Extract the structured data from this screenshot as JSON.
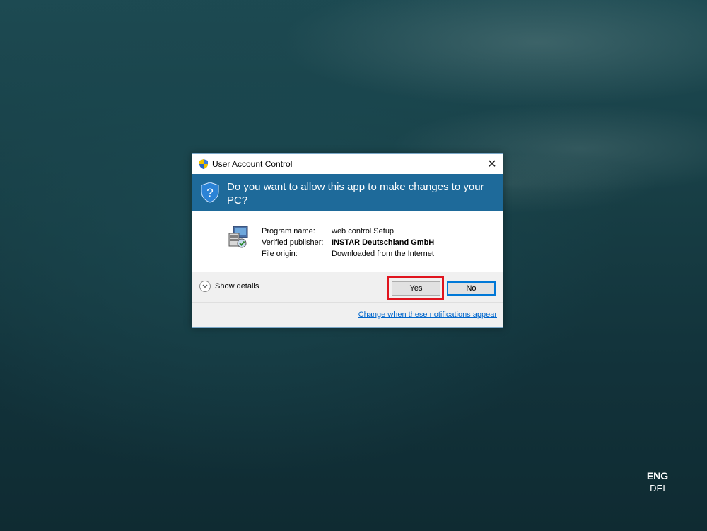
{
  "dialog": {
    "title": "User Account Control",
    "close_label": "✕",
    "question": "Do you want to allow this app to make changes to your PC?",
    "info": [
      {
        "label": "Program name:",
        "value": "web control Setup",
        "bold": false
      },
      {
        "label": "Verified publisher:",
        "value": "INSTAR Deutschland GmbH",
        "bold": true
      },
      {
        "label": "File origin:",
        "value": "Downloaded from the Internet",
        "bold": false
      }
    ],
    "show_details_label": "Show details",
    "yes_label": "Yes",
    "no_label": "No",
    "change_link": "Change when these notifications appear",
    "icons": {
      "title": "uac-shield-icon",
      "banner": "question-shield-icon",
      "app": "installer-icon",
      "details": "chevron-down-icon"
    },
    "colors": {
      "banner": "#1e6a9a",
      "highlight": "#e0141e",
      "link": "#0066cc"
    }
  },
  "language": {
    "code": "ENG",
    "layout": "DEI"
  }
}
